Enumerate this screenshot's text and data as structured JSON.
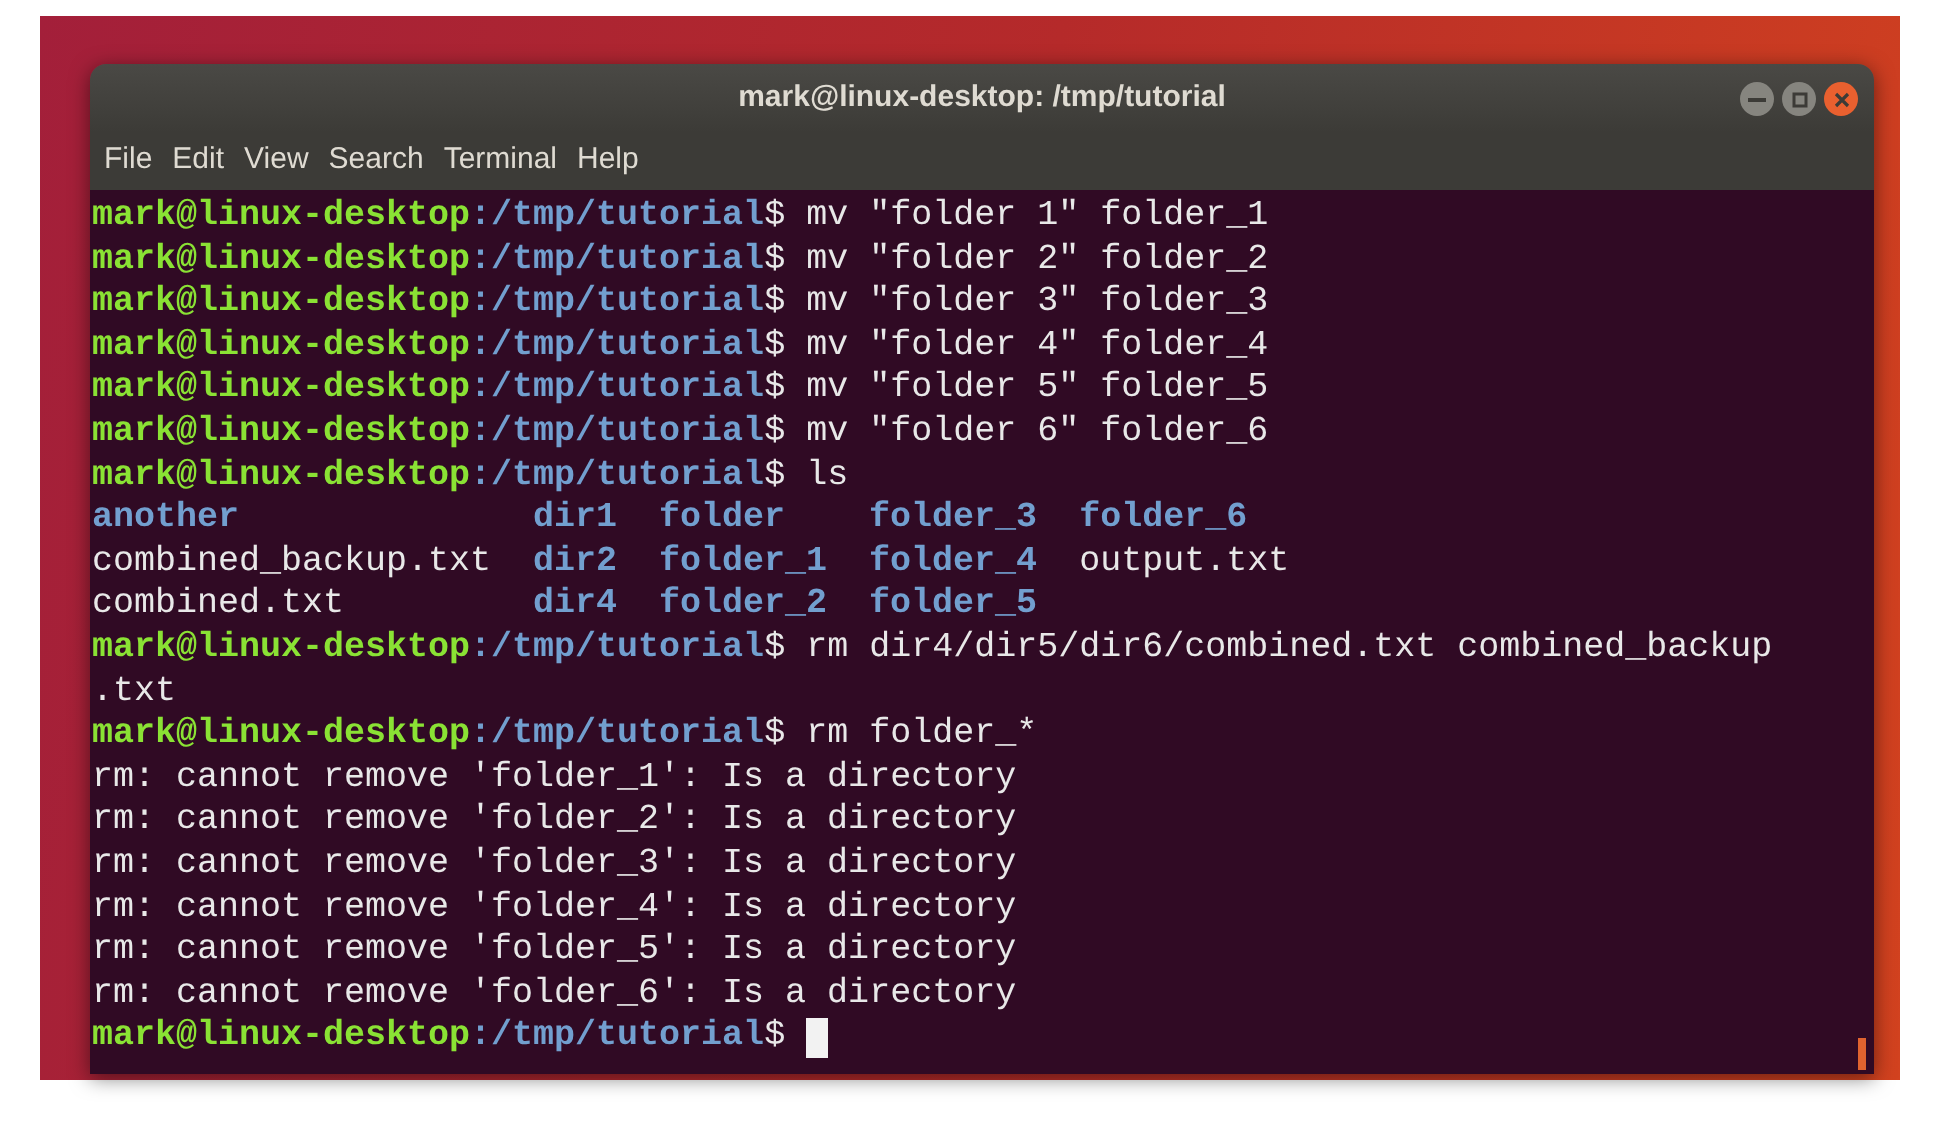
{
  "window": {
    "title": "mark@linux-desktop: /tmp/tutorial"
  },
  "menu": [
    "File",
    "Edit",
    "View",
    "Search",
    "Terminal",
    "Help"
  ],
  "lines": [
    {
      "kind": "prompt",
      "user_host": "mark@linux-desktop",
      "path": ":/tmp/tutorial",
      "symbol": "$",
      "command": "mv \"folder 1\" folder_1"
    },
    {
      "kind": "prompt",
      "user_host": "mark@linux-desktop",
      "path": ":/tmp/tutorial",
      "symbol": "$",
      "command": "mv \"folder 2\" folder_2"
    },
    {
      "kind": "prompt",
      "user_host": "mark@linux-desktop",
      "path": ":/tmp/tutorial",
      "symbol": "$",
      "command": "mv \"folder 3\" folder_3"
    },
    {
      "kind": "prompt",
      "user_host": "mark@linux-desktop",
      "path": ":/tmp/tutorial",
      "symbol": "$",
      "command": "mv \"folder 4\" folder_4"
    },
    {
      "kind": "prompt",
      "user_host": "mark@linux-desktop",
      "path": ":/tmp/tutorial",
      "symbol": "$",
      "command": "mv \"folder 5\" folder_5"
    },
    {
      "kind": "prompt",
      "user_host": "mark@linux-desktop",
      "path": ":/tmp/tutorial",
      "symbol": "$",
      "command": "mv \"folder 6\" folder_6"
    },
    {
      "kind": "prompt",
      "user_host": "mark@linux-desktop",
      "path": ":/tmp/tutorial",
      "symbol": "$",
      "command": "ls"
    },
    {
      "kind": "listing",
      "entries": [
        {
          "name": "another",
          "kind": "dir"
        },
        {
          "name": "dir1",
          "kind": "dir"
        },
        {
          "name": "folder",
          "kind": "dir"
        },
        {
          "name": "folder_3",
          "kind": "dir"
        },
        {
          "name": "folder_6",
          "kind": "dir"
        }
      ]
    },
    {
      "kind": "listing",
      "entries": [
        {
          "name": "combined_backup.txt",
          "kind": "file"
        },
        {
          "name": "dir2",
          "kind": "dir"
        },
        {
          "name": "folder_1",
          "kind": "dir"
        },
        {
          "name": "folder_4",
          "kind": "dir"
        },
        {
          "name": "output.txt",
          "kind": "file"
        }
      ]
    },
    {
      "kind": "listing",
      "entries": [
        {
          "name": "combined.txt",
          "kind": "file"
        },
        {
          "name": "dir4",
          "kind": "dir"
        },
        {
          "name": "folder_2",
          "kind": "dir"
        },
        {
          "name": "folder_5",
          "kind": "dir"
        }
      ]
    },
    {
      "kind": "prompt",
      "user_host": "mark@linux-desktop",
      "path": ":/tmp/tutorial",
      "symbol": "$",
      "command": "rm dir4/dir5/dir6/combined.txt combined_backup"
    },
    {
      "kind": "output",
      "text": ".txt"
    },
    {
      "kind": "prompt",
      "user_host": "mark@linux-desktop",
      "path": ":/tmp/tutorial",
      "symbol": "$",
      "command": "rm folder_*"
    },
    {
      "kind": "output",
      "text": "rm: cannot remove 'folder_1': Is a directory"
    },
    {
      "kind": "output",
      "text": "rm: cannot remove 'folder_2': Is a directory"
    },
    {
      "kind": "output",
      "text": "rm: cannot remove 'folder_3': Is a directory"
    },
    {
      "kind": "output",
      "text": "rm: cannot remove 'folder_4': Is a directory"
    },
    {
      "kind": "output",
      "text": "rm: cannot remove 'folder_5': Is a directory"
    },
    {
      "kind": "output",
      "text": "rm: cannot remove 'folder_6': Is a directory"
    },
    {
      "kind": "prompt",
      "user_host": "mark@linux-desktop",
      "path": ":/tmp/tutorial",
      "symbol": "$",
      "cursor": true
    }
  ]
}
